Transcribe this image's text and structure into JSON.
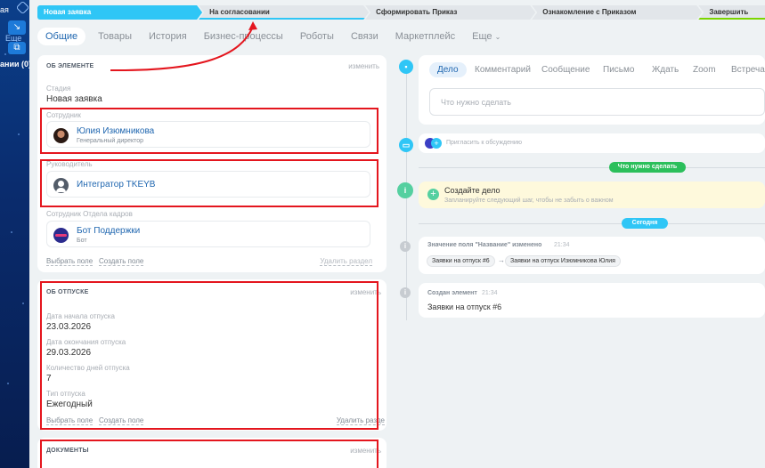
{
  "leftbar": {
    "text_top": "ая",
    "btn_more": "Еще",
    "text_bottom": "ании (0)"
  },
  "stages": [
    "Новая заявка",
    "На согласовании",
    "Сформировать Приказ",
    "Ознакомление с Приказом",
    "Завершить"
  ],
  "tabs": [
    "Общие",
    "Товары",
    "История",
    "Бизнес-процессы",
    "Роботы",
    "Связи",
    "Маркетплейс",
    "Еще"
  ],
  "about": {
    "title": "ОБ ЭЛЕМЕНТЕ",
    "edit": "изменить",
    "stage_label": "Стадия",
    "stage_value": "Новая заявка",
    "employee_label": "Сотрудник",
    "employee_name": "Юлия Изюмникова",
    "employee_role": "Генеральный директор",
    "manager_label": "Руководитель",
    "manager_name": "Интегратор TKEYB",
    "hr_label": "Сотрудник Отдела кадров",
    "hr_name": "Бот Поддержки",
    "hr_role": "Бот",
    "select_field": "Выбрать поле",
    "create_field": "Создать поле",
    "delete_section": "Удалить раздел"
  },
  "vacation": {
    "title": "ОБ ОТПУСКЕ",
    "edit": "изменить",
    "start_label": "Дата начала отпуска",
    "start_value": "23.03.2026",
    "end_label": "Дата окончания отпуска",
    "end_value": "29.03.2026",
    "days_label": "Количество дней отпуска",
    "days_value": "7",
    "type_label": "Тип отпуска",
    "type_value": "Ежегодный",
    "select_field": "Выбрать поле",
    "create_field": "Создать поле",
    "delete_section": "Удалить разде"
  },
  "documents": {
    "title": "ДОКУМЕНТЫ",
    "edit": "изменить"
  },
  "activity": {
    "tabs": [
      "Дело",
      "Комментарий",
      "Сообщение",
      "Письмо",
      "Ждать",
      "Zoom",
      "Встреча"
    ],
    "placeholder": "Что нужно сделать"
  },
  "timeline": {
    "invite": "Пригласить к обсуждению",
    "todo_pill": "Что нужно сделать",
    "create_title": "Создайте дело",
    "create_sub": "Запланируйте следующий шаг, чтобы не забыть о важном",
    "today_pill": "Сегодня",
    "event1_title": "Значение поля \"Название\" изменено",
    "event1_time": "21:34",
    "event1_old": "Заявки на отпуск #6",
    "event1_arrow": "→",
    "event1_new": "Заявки на отпуск Изюмникова Юлия",
    "event2_title": "Создан элемент",
    "event2_time": "21:34",
    "event2_value": "Заявки на отпуск #6"
  },
  "colors": {
    "accent": "#2fc6f6",
    "link": "#2067b0",
    "highlight_red": "#e4161e",
    "green": "#55d0a0"
  }
}
